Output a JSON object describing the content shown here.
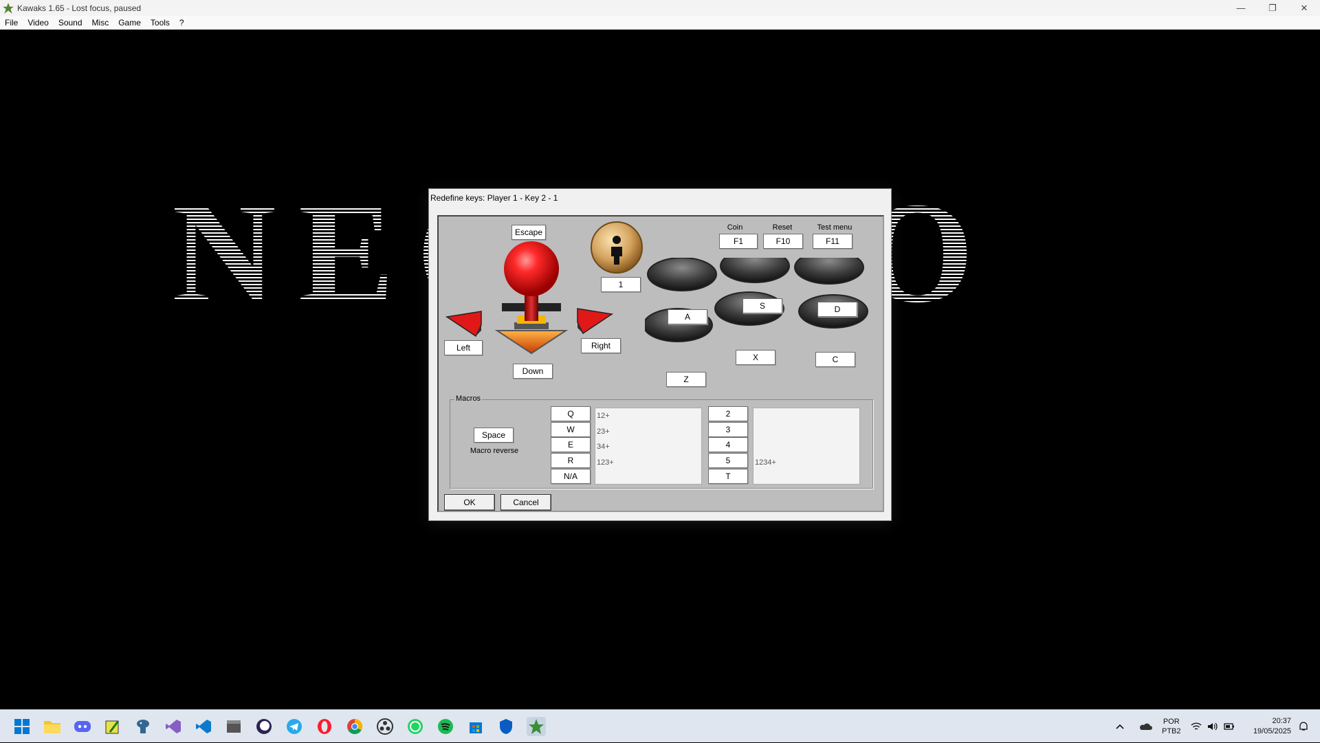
{
  "window": {
    "title": "Kawaks 1.65 - Lost focus, paused",
    "minimize": "—",
    "maximize": "❐",
    "close": "✕"
  },
  "menu": [
    "File",
    "Video",
    "Sound",
    "Misc",
    "Game",
    "Tools",
    "?"
  ],
  "game_logo": "NEO GEO",
  "dialog": {
    "title": "Redefine keys: Player 1 - Key 2 - 1",
    "up_key": "Escape",
    "left_key": "Left",
    "right_key": "Right",
    "down_key": "Down",
    "start_key": "1",
    "coin_label": "Coin",
    "coin_key": "F1",
    "reset_label": "Reset",
    "reset_key": "F10",
    "test_label": "Test menu",
    "test_key": "F11",
    "btn_a": "A",
    "btn_s": "S",
    "btn_d": "D",
    "btn_z": "Z",
    "btn_x": "X",
    "btn_c": "C",
    "macros": {
      "legend": "Macros",
      "reverse_key": "Space",
      "reverse_label": "Macro reverse",
      "keys_left": [
        "Q",
        "W",
        "E",
        "R",
        "N/A"
      ],
      "combos_left": [
        "12+",
        "23+",
        "34+",
        "123+"
      ],
      "keys_right": [
        "2",
        "3",
        "4",
        "5",
        "T"
      ],
      "combo_right": "1234+"
    },
    "ok": "OK",
    "cancel": "Cancel"
  },
  "taskbar": {
    "lang": "POR",
    "layout": "PTB2",
    "time": "20:37",
    "date": "19/05/2025"
  },
  "colors": {
    "titlebar": "#f3f3f3",
    "dialog_panel": "#bdbdbd",
    "joystick_ball": "#e0191f",
    "taskbar": "#dfe6ef"
  }
}
